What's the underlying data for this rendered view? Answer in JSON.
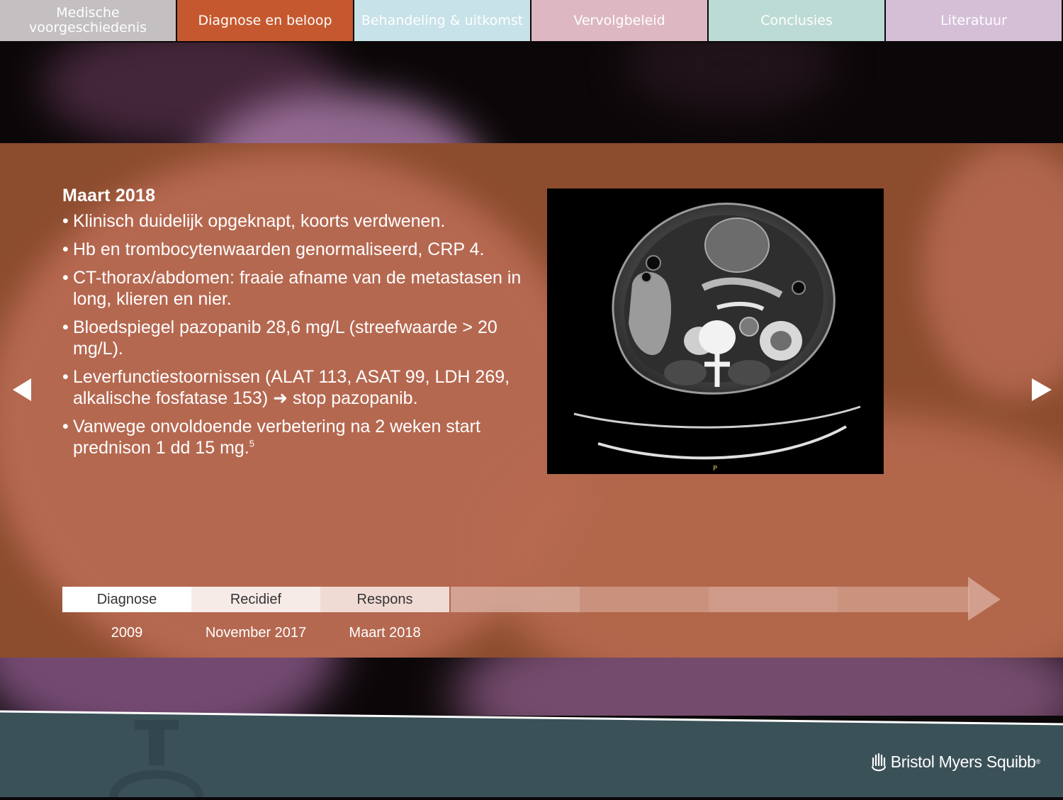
{
  "nav": {
    "tabs": [
      {
        "label": "Medische voorgeschiedenis",
        "color": "#c4bfc1",
        "active": false
      },
      {
        "label": "Diagnose en beloop",
        "color": "#c5582e",
        "active": true
      },
      {
        "label": "Behandeling & uitkomst",
        "color": "#c7e2e8",
        "active": false
      },
      {
        "label": "Vervolgbeleid",
        "color": "#ddb8c2",
        "active": false
      },
      {
        "label": "Conclusies",
        "color": "#bddbd5",
        "active": false
      },
      {
        "label": "Literatuur",
        "color": "#d5bfd7",
        "active": false
      }
    ]
  },
  "main": {
    "heading": "Maart 2018",
    "bullets": [
      {
        "text": "Klinisch duidelijk opgeknapt, koorts verdwenen."
      },
      {
        "text": "Hb en trombocytenwaarden genormaliseerd, CRP 4."
      },
      {
        "text": "CT-thorax/abdomen: fraaie afname van de metastasen in long, klieren en nier."
      },
      {
        "text": "Bloedspiegel pazopanib 28,6 mg/L (streefwaarde > 20 mg/L)."
      },
      {
        "text": "Leverfunctiestoornissen (ALAT 113, ASAT 99, LDH 269, alkalische fosfatase 153) ➜ stop pazopanib."
      },
      {
        "text": "Vanwege onvoldoende verbetering na 2 weken start prednison 1 dd 15 mg.",
        "sup": "5"
      }
    ],
    "image_marker": "P"
  },
  "timeline": {
    "stages": [
      {
        "label": "Diagnose",
        "date": "2009"
      },
      {
        "label": "Recidief",
        "date": "November 2017"
      },
      {
        "label": "Respons",
        "date": "Maart 2018"
      }
    ]
  },
  "nav_arrows": {
    "prev_icon": "arrow-left-icon",
    "next_icon": "arrow-right-icon"
  },
  "footer": {
    "brand": "Bristol Myers Squibb",
    "trademark": "®"
  },
  "colors": {
    "panel": "#8c4c2e",
    "footer": "#3a5158",
    "accent": "#c5582e"
  }
}
